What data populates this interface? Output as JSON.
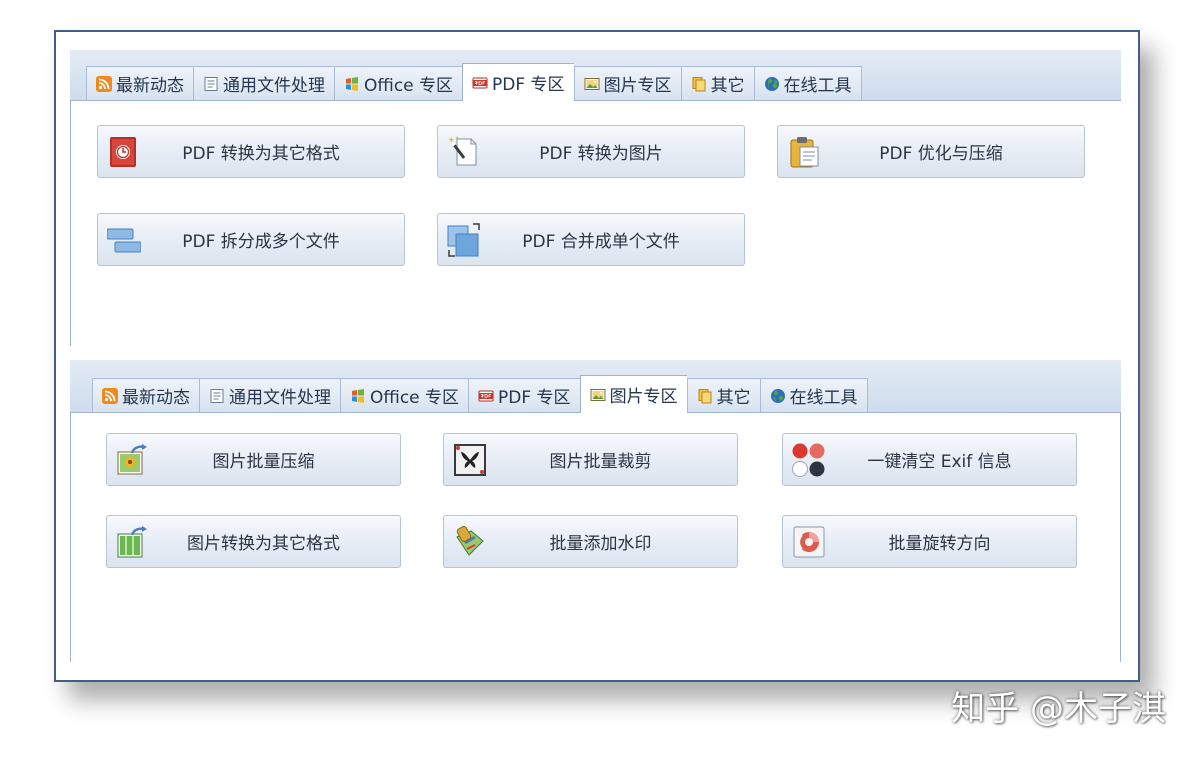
{
  "pdf_panel": {
    "tabs": [
      {
        "label": "最新动态",
        "icon": "rss-icon"
      },
      {
        "label": "通用文件处理",
        "icon": "document-icon"
      },
      {
        "label": "Office 专区",
        "icon": "windows-logo-icon"
      },
      {
        "label": "PDF 专区",
        "icon": "pdf-icon",
        "active": true
      },
      {
        "label": "图片专区",
        "icon": "picture-icon"
      },
      {
        "label": "其它",
        "icon": "copy-files-icon"
      },
      {
        "label": "在线工具",
        "icon": "globe-icon"
      }
    ],
    "buttons": [
      {
        "label": "PDF 转换为其它格式",
        "icon": "pdf-convert-red-icon"
      },
      {
        "label": "PDF 转换为图片",
        "icon": "magic-wand-page-icon"
      },
      {
        "label": "PDF 优化与压缩",
        "icon": "clipboard-icon"
      },
      {
        "label": "PDF 拆分成多个文件",
        "icon": "split-icon"
      },
      {
        "label": "PDF 合并成单个文件",
        "icon": "merge-icon"
      }
    ]
  },
  "image_panel": {
    "tabs": [
      {
        "label": "最新动态",
        "icon": "rss-icon"
      },
      {
        "label": "通用文件处理",
        "icon": "document-icon"
      },
      {
        "label": "Office 专区",
        "icon": "windows-logo-icon"
      },
      {
        "label": "PDF 专区",
        "icon": "pdf-icon"
      },
      {
        "label": "图片专区",
        "icon": "picture-icon",
        "active": true
      },
      {
        "label": "其它",
        "icon": "copy-files-icon"
      },
      {
        "label": "在线工具",
        "icon": "globe-icon"
      }
    ],
    "buttons": [
      {
        "label": "图片批量压缩",
        "icon": "image-compress-icon"
      },
      {
        "label": "图片批量裁剪",
        "icon": "image-crop-icon"
      },
      {
        "label": "一键清空 Exif 信息",
        "icon": "exif-dots-icon"
      },
      {
        "label": "图片转换为其它格式",
        "icon": "image-convert-icon"
      },
      {
        "label": "批量添加水印",
        "icon": "watermark-stamp-icon"
      },
      {
        "label": "批量旋转方向",
        "icon": "rotate-icon"
      }
    ]
  },
  "watermark": {
    "text": "知乎 @木子淇"
  },
  "colors": {
    "frame": "#3f5f86",
    "tab_strip": "#d9e4f1",
    "button_face": "#e5ecf5",
    "text": "#2a3442"
  }
}
